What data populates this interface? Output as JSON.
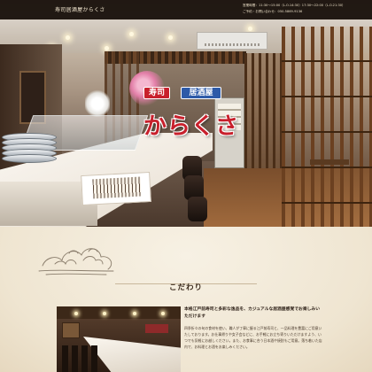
{
  "header": {
    "site_title": "寿司居酒屋からくさ",
    "hours_line": "営業時間：11:30～15:00（L.O.14:30）17:30～22:00（L.O.21:30）",
    "reservation_line": "ご予約・お問い合わせ：050-5869-9136"
  },
  "hero": {
    "sushi_badge": "寿司",
    "izakaya_badge": "居酒屋",
    "shop_name": "からくさ"
  },
  "section": {
    "title": "こだわり",
    "lead": "本格江戸前寿司と多彩な逸品を、カジュアルな居酒屋感覚でお楽しみいただけます",
    "body": "四季折々の旬の食材を使い、職人が丁寧に握る江戸前寿司と、一品料理を豊富にご用意いたしております。お仕事帰りや女子会などに、お手軽にお立ち寄りいただけますよう、いつでも気軽にお越しください。また、お食事に合う日本酒や焼酎もご用意。落ち着いた店内で、お料理とお酒をお楽しみください。"
  },
  "colors": {
    "accent_red": "#c8202c",
    "accent_blue": "#2d5aa8",
    "background": "#efe5d1"
  }
}
